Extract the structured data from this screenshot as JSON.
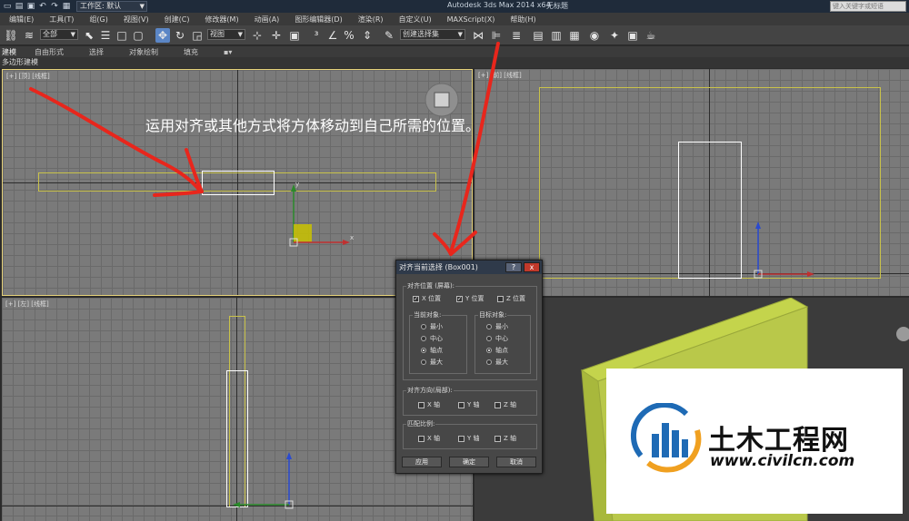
{
  "titlebar": {
    "workspace": "工作区: 默认",
    "app_title": "Autodesk 3ds Max  2014 x64",
    "doc_title": "无标题",
    "search_placeholder": "键入关键字或短语"
  },
  "menu": [
    "编辑(E)",
    "工具(T)",
    "组(G)",
    "视图(V)",
    "创建(C)",
    "修改器(M)",
    "动画(A)",
    "图形编辑器(D)",
    "渲染(R)",
    "自定义(U)",
    "MAXScript(X)",
    "帮助(H)"
  ],
  "toolbar": {
    "filter_select": "全部",
    "coord_select": "视图",
    "selection_set": "创建选择集"
  },
  "ribbon": {
    "tabs": [
      "建模",
      "自由形式",
      "选择",
      "对象绘制",
      "填充"
    ],
    "subtitle": "多边形建模"
  },
  "viewports": {
    "top_label": "[+] [顶] [线框]",
    "front_label": "[+] [前] [线框]",
    "left_label": "[+] [左] [线框]"
  },
  "instruction": "运用对齐或其他方式将方体移动到自己所需的位置。",
  "dialog": {
    "title": "对齐当前选择 (Box001)",
    "help": "?",
    "close": "x",
    "align_pos_title": "对齐位置 (屏幕):",
    "x_pos": "X 位置",
    "y_pos": "Y 位置",
    "z_pos": "Z 位置",
    "current_title": "当前对象:",
    "target_title": "目标对象:",
    "options": [
      "最小",
      "中心",
      "轴点",
      "最大"
    ],
    "orient_title": "对齐方向(局部):",
    "scale_title": "匹配比例:",
    "x_axis": "X 轴",
    "y_axis": "Y 轴",
    "z_axis": "Z 轴",
    "apply": "应用",
    "ok": "确定",
    "cancel": "取消"
  },
  "watermark": {
    "text": "土木工程网",
    "url": "www.civilcn.com"
  },
  "colors": {
    "annotation": "#e8261c",
    "selection": "#e6d27a",
    "object_box": "#ffffff"
  }
}
